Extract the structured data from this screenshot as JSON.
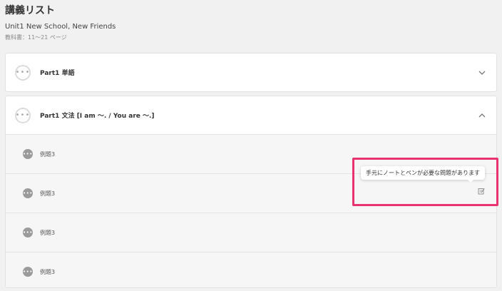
{
  "header": {
    "page_title": "講義リスト",
    "unit_title": "Unit1 New School, New Friends",
    "textbook_pages": "教科書：11〜21 ページ"
  },
  "sections": [
    {
      "title": "Part1 単語",
      "state": "collapsed"
    },
    {
      "title": "Part1 文法 [I am 〜. / You are 〜.]",
      "state": "expanded",
      "items": [
        {
          "label": "例題3"
        },
        {
          "label": "例題3"
        },
        {
          "label": "例題3"
        },
        {
          "label": "例題3"
        }
      ]
    }
  ],
  "tooltip": {
    "text": "手元にノートとペンが必要な問題があります"
  },
  "colors": {
    "highlight": "#e8336e",
    "background": "#f1f1f1"
  }
}
